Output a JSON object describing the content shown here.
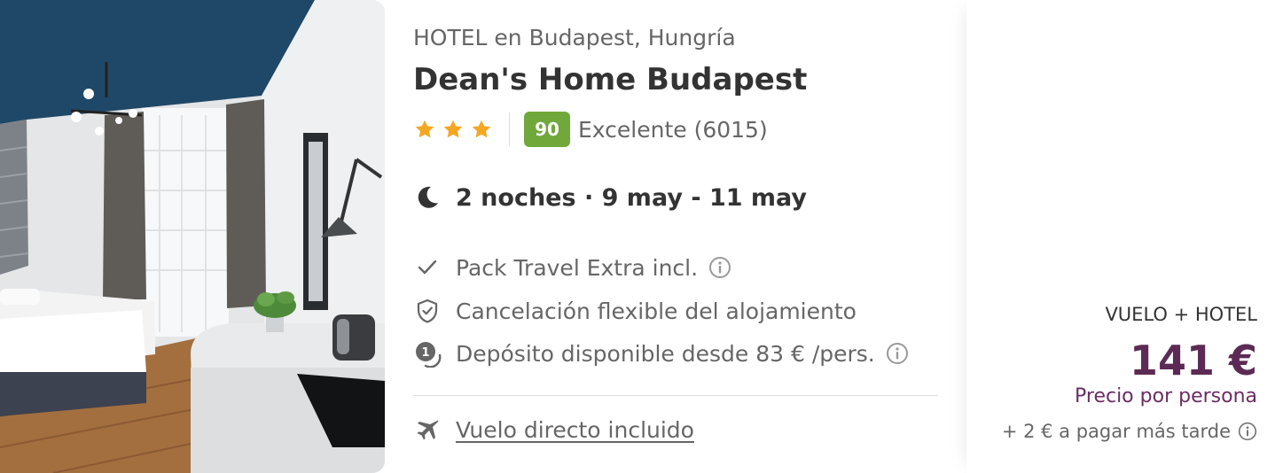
{
  "hotel": {
    "subtitle": "HOTEL en Budapest, Hungría",
    "name": "Dean's Home Budapest",
    "stars": 3,
    "score": "90",
    "score_text": "Excelente (6015)",
    "dates": "2 noches · 9 may - 11 may"
  },
  "features": [
    {
      "icon": "check-icon",
      "label": "Pack Travel Extra incl.",
      "has_info": true
    },
    {
      "icon": "shield-check-icon",
      "label": "Cancelación flexible del alojamiento",
      "has_info": false
    },
    {
      "icon": "deposit-icon",
      "label": "Depósito disponible desde 83 € /pers.",
      "has_info": true
    }
  ],
  "flight": {
    "icon": "airplane-icon",
    "label": "Vuelo directo incluido"
  },
  "price": {
    "type_label": "VUELO + HOTEL",
    "amount": "141 €",
    "per_person": "Precio por persona",
    "extra": "+ 2 € a pagar más tarde"
  },
  "colors": {
    "score_badge": "#70a83b",
    "star": "#f5a623",
    "price": "#5c2a55",
    "ceiling": "#1f4868"
  }
}
